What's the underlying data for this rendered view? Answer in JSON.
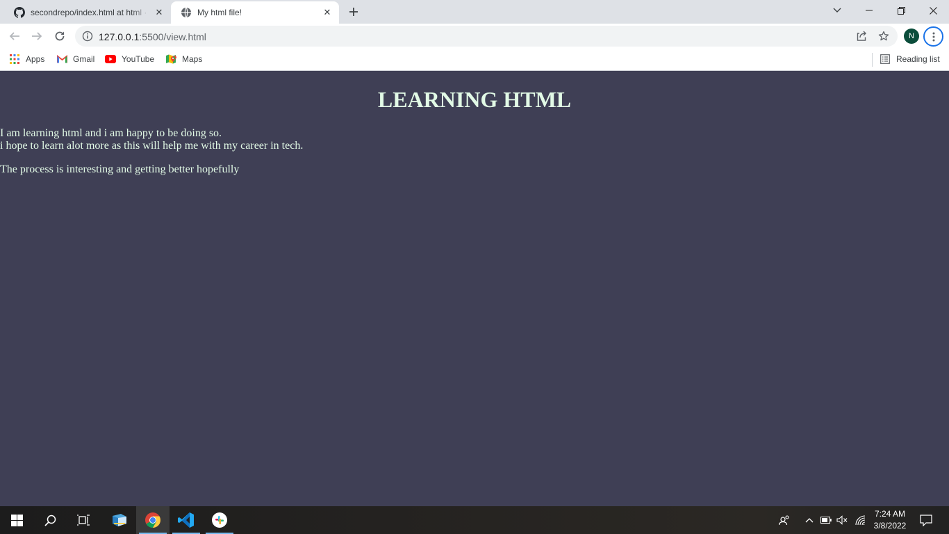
{
  "browser": {
    "tabs": [
      {
        "title": "secondrepo/index.html at html · ",
        "favicon": "github-icon",
        "active": false
      },
      {
        "title": "My html file!",
        "favicon": "globe-icon",
        "active": true
      }
    ],
    "url": {
      "host": "127.0.0.1",
      "path": ":5500/view.html"
    },
    "profile_initial": "N",
    "bookmarks": [
      {
        "label": "Apps",
        "icon": "apps-grid-icon"
      },
      {
        "label": "Gmail",
        "icon": "gmail-icon"
      },
      {
        "label": "YouTube",
        "icon": "youtube-icon"
      },
      {
        "label": "Maps",
        "icon": "maps-icon"
      }
    ],
    "reading_list": "Reading list"
  },
  "page": {
    "heading": "LEARNING HTML",
    "paragraph1_line1": "I am learning html and i am happy to be doing so.",
    "paragraph1_line2": "i hope to learn alot more as this will help me with my career in tech.",
    "paragraph2": "The process is interesting and getting better hopefully",
    "background_color": "#3f3f55",
    "text_color": "#e2fae6"
  },
  "taskbar": {
    "apps": [
      "windows-start-icon",
      "search-icon",
      "task-view-icon",
      "file-explorer-icon",
      "chrome-icon",
      "vscode-icon",
      "slack-icon"
    ],
    "time": "7:24 AM",
    "date": "3/8/2022"
  }
}
